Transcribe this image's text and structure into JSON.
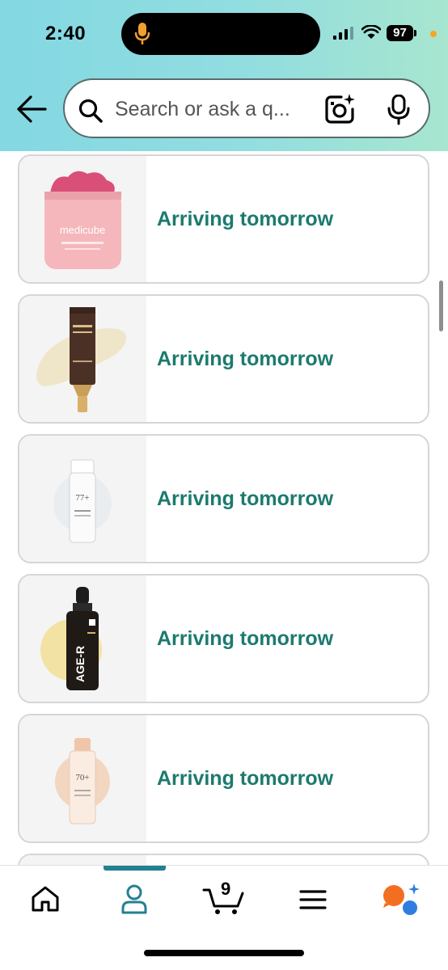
{
  "status_bar": {
    "time": "2:40",
    "battery": "97"
  },
  "search": {
    "placeholder": "Search or ask a q..."
  },
  "orders": [
    {
      "status": "Arriving tomorrow",
      "product_icon": "pink-cream-jar"
    },
    {
      "status": "Arriving tomorrow",
      "product_icon": "eye-cream-tube"
    },
    {
      "status": "Arriving tomorrow",
      "product_icon": "clear-toner-bottle"
    },
    {
      "status": "Arriving tomorrow",
      "product_icon": "dropper-serum-bottle"
    },
    {
      "status": "Arriving tomorrow",
      "product_icon": "peach-toner-bottle"
    }
  ],
  "nav": {
    "cart_count": "9",
    "active": "profile"
  },
  "colors": {
    "header_start": "#83d8e2",
    "header_end": "#a7e6cf",
    "status_text": "#1c7a6e",
    "nav_accent": "#238090"
  }
}
